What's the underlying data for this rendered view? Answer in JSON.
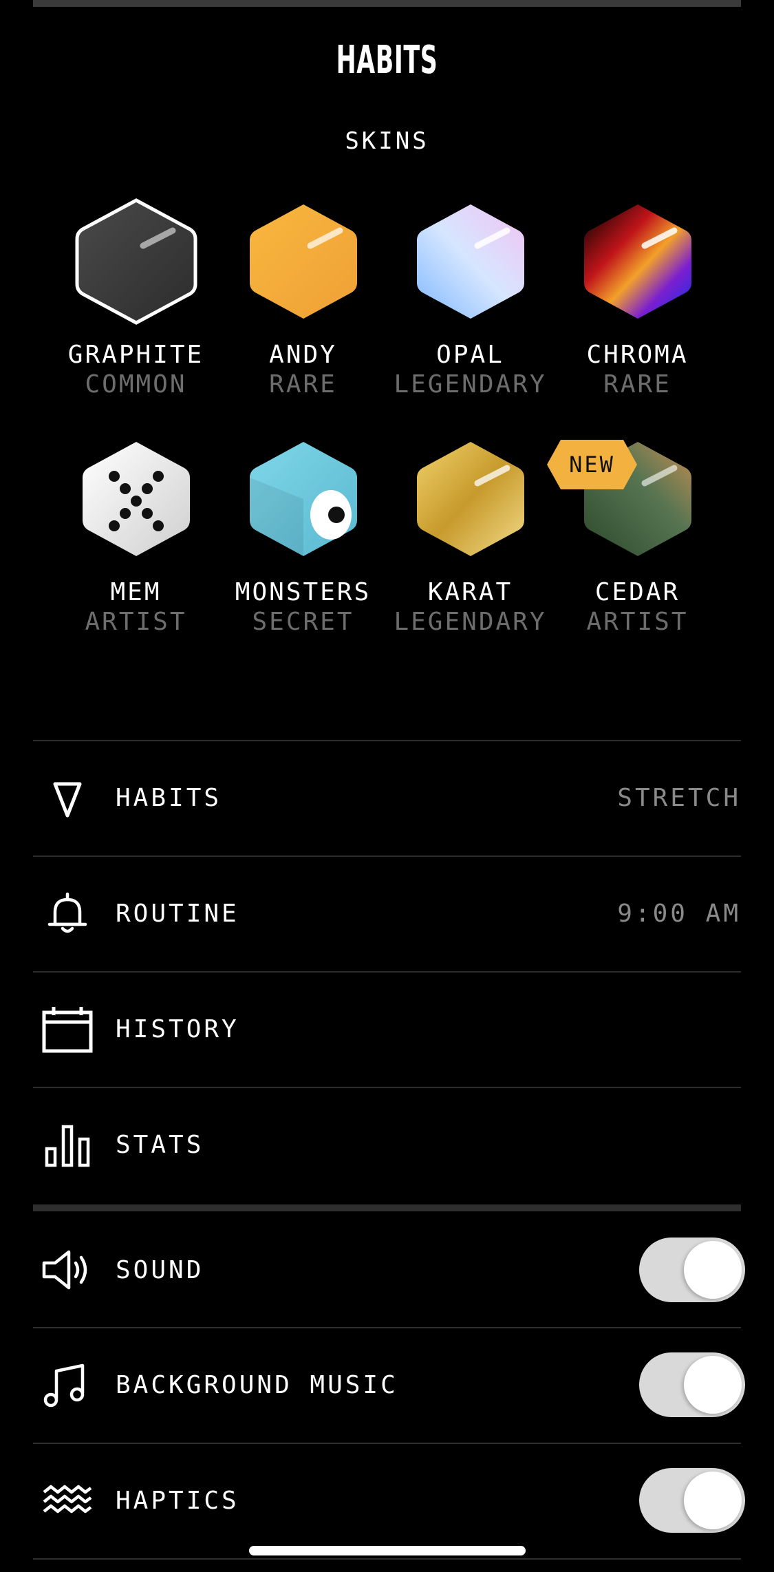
{
  "header": {
    "title": "HABITS",
    "section": "SKINS"
  },
  "skins": [
    {
      "name": "GRAPHITE",
      "rarity": "COMMON",
      "selected": true,
      "color": "#3a3a3a"
    },
    {
      "name": "ANDY",
      "rarity": "RARE",
      "color": "#f4a63a"
    },
    {
      "name": "OPAL",
      "rarity": "LEGENDARY",
      "color": "#c9d8ff"
    },
    {
      "name": "CHROMA",
      "rarity": "RARE",
      "color": "#1a2fb8"
    },
    {
      "name": "MEM",
      "rarity": "ARTIST",
      "color": "#eeeeee"
    },
    {
      "name": "MONSTERS",
      "rarity": "SECRET",
      "color": "#6cc6da"
    },
    {
      "name": "KARAT",
      "rarity": "LEGENDARY",
      "color": "#d7b453"
    },
    {
      "name": "CEDAR",
      "rarity": "ARTIST",
      "color": "#496441",
      "badge": "NEW"
    }
  ],
  "settings": [
    {
      "icon": "triangle-icon",
      "label": "HABITS",
      "value": "STRETCH"
    },
    {
      "icon": "bell-icon",
      "label": "ROUTINE",
      "value": "9:00 AM"
    },
    {
      "icon": "calendar-icon",
      "label": "HISTORY"
    },
    {
      "icon": "bar-chart-icon",
      "label": "STATS"
    }
  ],
  "toggles": [
    {
      "icon": "speaker-icon",
      "label": "SOUND",
      "on": true
    },
    {
      "icon": "music-note-icon",
      "label": "BACKGROUND MUSIC",
      "on": true
    },
    {
      "icon": "waves-icon",
      "label": "HAPTICS",
      "on": true
    }
  ],
  "colors": {
    "badge": "#f3b23f",
    "toggle_track": "#d9d9d9",
    "muted_text": "#6d6d6d"
  }
}
